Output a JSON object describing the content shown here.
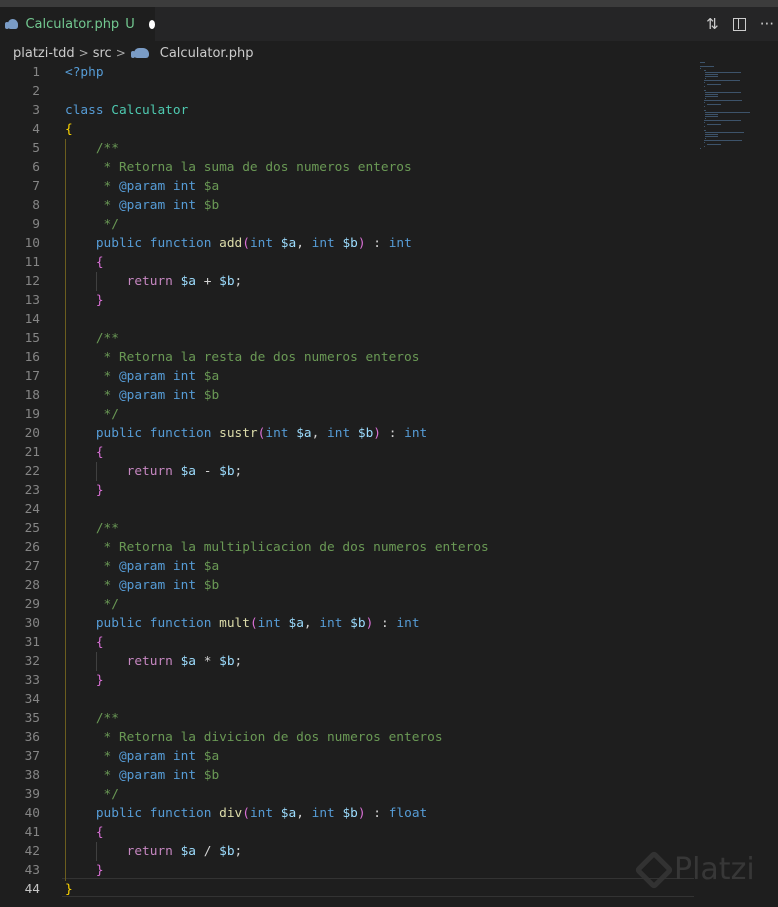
{
  "tab": {
    "filename": "Calculator.php",
    "status": "U",
    "icon": "php-elephant-icon"
  },
  "actions": {
    "compare_icon": "git-compare-icon",
    "split_icon": "split-editor-icon",
    "more": "···"
  },
  "breadcrumb": [
    "platzi-tdd",
    "src",
    "Calculator.php"
  ],
  "watermark": "Platzi",
  "current_line": 44,
  "lines": [
    [
      [
        "kw",
        "<?php"
      ]
    ],
    [],
    [
      [
        "kw",
        "class "
      ],
      [
        "cls",
        "Calculator"
      ]
    ],
    [
      [
        "b1",
        "{"
      ]
    ],
    [
      [
        "pl",
        "    "
      ],
      [
        "cm",
        "/**"
      ]
    ],
    [
      [
        "pl",
        "     "
      ],
      [
        "cm",
        "* Retorna la suma de dos numeros enteros"
      ]
    ],
    [
      [
        "pl",
        "     "
      ],
      [
        "cm",
        "* "
      ],
      [
        "tag",
        "@param"
      ],
      [
        "pl",
        " "
      ],
      [
        "tag",
        "int"
      ],
      [
        "pl",
        " "
      ],
      [
        "cv",
        "$a"
      ]
    ],
    [
      [
        "pl",
        "     "
      ],
      [
        "cm",
        "* "
      ],
      [
        "tag",
        "@param"
      ],
      [
        "pl",
        " "
      ],
      [
        "tag",
        "int"
      ],
      [
        "pl",
        " "
      ],
      [
        "cv",
        "$b"
      ]
    ],
    [
      [
        "pl",
        "     "
      ],
      [
        "cm",
        "*/"
      ]
    ],
    [
      [
        "pl",
        "    "
      ],
      [
        "kw",
        "public function "
      ],
      [
        "fn",
        "add"
      ],
      [
        "b2",
        "("
      ],
      [
        "kw",
        "int "
      ],
      [
        "var",
        "$a"
      ],
      [
        "pl",
        ", "
      ],
      [
        "kw",
        "int "
      ],
      [
        "var",
        "$b"
      ],
      [
        "b2",
        ")"
      ],
      [
        "pl",
        " : "
      ],
      [
        "kw",
        "int"
      ]
    ],
    [
      [
        "pl",
        "    "
      ],
      [
        "b2",
        "{"
      ]
    ],
    [
      [
        "pl",
        "        "
      ],
      [
        "ctl",
        "return "
      ],
      [
        "var",
        "$a"
      ],
      [
        "pl",
        " + "
      ],
      [
        "var",
        "$b"
      ],
      [
        "pl",
        ";"
      ]
    ],
    [
      [
        "pl",
        "    "
      ],
      [
        "b2",
        "}"
      ]
    ],
    [],
    [
      [
        "pl",
        "    "
      ],
      [
        "cm",
        "/**"
      ]
    ],
    [
      [
        "pl",
        "     "
      ],
      [
        "cm",
        "* Retorna la resta de dos numeros enteros"
      ]
    ],
    [
      [
        "pl",
        "     "
      ],
      [
        "cm",
        "* "
      ],
      [
        "tag",
        "@param"
      ],
      [
        "pl",
        " "
      ],
      [
        "tag",
        "int"
      ],
      [
        "pl",
        " "
      ],
      [
        "cv",
        "$a"
      ]
    ],
    [
      [
        "pl",
        "     "
      ],
      [
        "cm",
        "* "
      ],
      [
        "tag",
        "@param"
      ],
      [
        "pl",
        " "
      ],
      [
        "tag",
        "int"
      ],
      [
        "pl",
        " "
      ],
      [
        "cv",
        "$b"
      ]
    ],
    [
      [
        "pl",
        "     "
      ],
      [
        "cm",
        "*/"
      ]
    ],
    [
      [
        "pl",
        "    "
      ],
      [
        "kw",
        "public function "
      ],
      [
        "fn",
        "sustr"
      ],
      [
        "b2",
        "("
      ],
      [
        "kw",
        "int "
      ],
      [
        "var",
        "$a"
      ],
      [
        "pl",
        ", "
      ],
      [
        "kw",
        "int "
      ],
      [
        "var",
        "$b"
      ],
      [
        "b2",
        ")"
      ],
      [
        "pl",
        " : "
      ],
      [
        "kw",
        "int"
      ]
    ],
    [
      [
        "pl",
        "    "
      ],
      [
        "b2",
        "{"
      ]
    ],
    [
      [
        "pl",
        "        "
      ],
      [
        "ctl",
        "return "
      ],
      [
        "var",
        "$a"
      ],
      [
        "pl",
        " - "
      ],
      [
        "var",
        "$b"
      ],
      [
        "pl",
        ";"
      ]
    ],
    [
      [
        "pl",
        "    "
      ],
      [
        "b2",
        "}"
      ]
    ],
    [],
    [
      [
        "pl",
        "    "
      ],
      [
        "cm",
        "/**"
      ]
    ],
    [
      [
        "pl",
        "     "
      ],
      [
        "cm",
        "* Retorna la multiplicacion de dos numeros enteros"
      ]
    ],
    [
      [
        "pl",
        "     "
      ],
      [
        "cm",
        "* "
      ],
      [
        "tag",
        "@param"
      ],
      [
        "pl",
        " "
      ],
      [
        "tag",
        "int"
      ],
      [
        "pl",
        " "
      ],
      [
        "cv",
        "$a"
      ]
    ],
    [
      [
        "pl",
        "     "
      ],
      [
        "cm",
        "* "
      ],
      [
        "tag",
        "@param"
      ],
      [
        "pl",
        " "
      ],
      [
        "tag",
        "int"
      ],
      [
        "pl",
        " "
      ],
      [
        "cv",
        "$b"
      ]
    ],
    [
      [
        "pl",
        "     "
      ],
      [
        "cm",
        "*/"
      ]
    ],
    [
      [
        "pl",
        "    "
      ],
      [
        "kw",
        "public function "
      ],
      [
        "fn",
        "mult"
      ],
      [
        "b2",
        "("
      ],
      [
        "kw",
        "int "
      ],
      [
        "var",
        "$a"
      ],
      [
        "pl",
        ", "
      ],
      [
        "kw",
        "int "
      ],
      [
        "var",
        "$b"
      ],
      [
        "b2",
        ")"
      ],
      [
        "pl",
        " : "
      ],
      [
        "kw",
        "int"
      ]
    ],
    [
      [
        "pl",
        "    "
      ],
      [
        "b2",
        "{"
      ]
    ],
    [
      [
        "pl",
        "        "
      ],
      [
        "ctl",
        "return "
      ],
      [
        "var",
        "$a"
      ],
      [
        "pl",
        " * "
      ],
      [
        "var",
        "$b"
      ],
      [
        "pl",
        ";"
      ]
    ],
    [
      [
        "pl",
        "    "
      ],
      [
        "b2",
        "}"
      ]
    ],
    [],
    [
      [
        "pl",
        "    "
      ],
      [
        "cm",
        "/**"
      ]
    ],
    [
      [
        "pl",
        "     "
      ],
      [
        "cm",
        "* Retorna la divicion de dos numeros enteros"
      ]
    ],
    [
      [
        "pl",
        "     "
      ],
      [
        "cm",
        "* "
      ],
      [
        "tag",
        "@param"
      ],
      [
        "pl",
        " "
      ],
      [
        "tag",
        "int"
      ],
      [
        "pl",
        " "
      ],
      [
        "cv",
        "$a"
      ]
    ],
    [
      [
        "pl",
        "     "
      ],
      [
        "cm",
        "* "
      ],
      [
        "tag",
        "@param"
      ],
      [
        "pl",
        " "
      ],
      [
        "tag",
        "int"
      ],
      [
        "pl",
        " "
      ],
      [
        "cv",
        "$b"
      ]
    ],
    [
      [
        "pl",
        "     "
      ],
      [
        "cm",
        "*/"
      ]
    ],
    [
      [
        "pl",
        "    "
      ],
      [
        "kw",
        "public function "
      ],
      [
        "fn",
        "div"
      ],
      [
        "b2",
        "("
      ],
      [
        "kw",
        "int "
      ],
      [
        "var",
        "$a"
      ],
      [
        "pl",
        ", "
      ],
      [
        "kw",
        "int "
      ],
      [
        "var",
        "$b"
      ],
      [
        "b2",
        ")"
      ],
      [
        "pl",
        " : "
      ],
      [
        "kw",
        "float"
      ]
    ],
    [
      [
        "pl",
        "    "
      ],
      [
        "b2",
        "{"
      ]
    ],
    [
      [
        "pl",
        "        "
      ],
      [
        "ctl",
        "return "
      ],
      [
        "var",
        "$a"
      ],
      [
        "pl",
        " / "
      ],
      [
        "var",
        "$b"
      ],
      [
        "pl",
        ";"
      ]
    ],
    [
      [
        "pl",
        "    "
      ],
      [
        "b2",
        "}"
      ]
    ],
    [
      [
        "b1",
        "}"
      ]
    ]
  ]
}
